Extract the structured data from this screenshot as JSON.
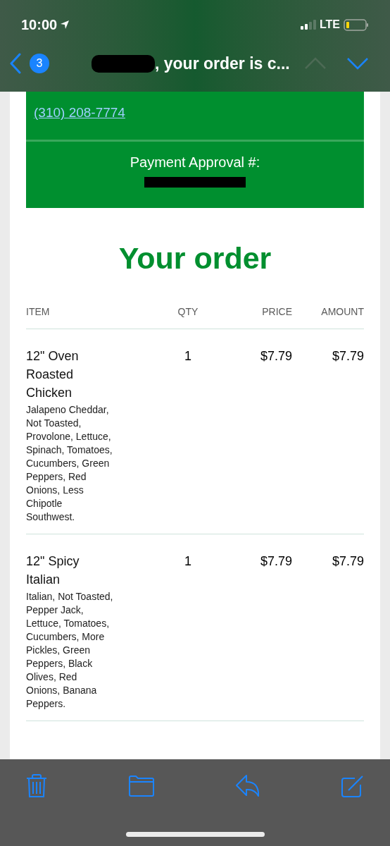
{
  "status_bar": {
    "time": "10:00",
    "network": "LTE"
  },
  "nav_bar": {
    "unread_count": "3",
    "subject": ", your order is c..."
  },
  "store_block": {
    "phone": "(310) 208-7774",
    "approval_label": "Payment Approval #:"
  },
  "order": {
    "title": "Your order",
    "columns": [
      "ITEM",
      "QTY",
      "PRICE",
      "AMOUNT"
    ],
    "rows": [
      {
        "name": "12\" Oven Roasted Chicken",
        "details": "Jalapeno Cheddar, Not Toasted, Provolone, Lettuce, Spinach, Tomatoes, Cucumbers, Green Peppers, Red Onions, Less Chipotle Southwest.",
        "qty": "1",
        "price": "$7.79",
        "amount": "$7.79"
      },
      {
        "name": "12\" Spicy Italian",
        "details": "Italian, Not Toasted, Pepper Jack, Lettuce, Tomatoes, Cucumbers, More Pickles, Green Peppers, Black Olives, Red Onions, Banana Peppers.",
        "qty": "1",
        "price": "$7.79",
        "amount": "$7.79"
      }
    ]
  }
}
